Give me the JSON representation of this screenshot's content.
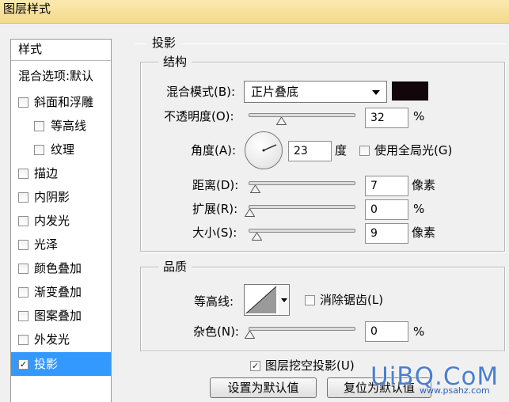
{
  "window": {
    "title": "图层样式"
  },
  "sidebar": {
    "header": "样式",
    "blend_options": "混合选项:默认",
    "items": [
      {
        "label": "斜面和浮雕",
        "checked": false,
        "selected": false
      },
      {
        "label": "等高线",
        "checked": false,
        "selected": false
      },
      {
        "label": "纹理",
        "checked": false,
        "selected": false
      },
      {
        "label": "描边",
        "checked": false,
        "selected": false
      },
      {
        "label": "内阴影",
        "checked": false,
        "selected": false
      },
      {
        "label": "内发光",
        "checked": false,
        "selected": false
      },
      {
        "label": "光泽",
        "checked": false,
        "selected": false
      },
      {
        "label": "颜色叠加",
        "checked": false,
        "selected": false
      },
      {
        "label": "渐变叠加",
        "checked": false,
        "selected": false
      },
      {
        "label": "图案叠加",
        "checked": false,
        "selected": false
      },
      {
        "label": "外发光",
        "checked": false,
        "selected": false
      },
      {
        "label": "投影",
        "checked": true,
        "selected": true
      }
    ]
  },
  "drop_shadow": {
    "section_title": "投影",
    "structure": {
      "title": "结构",
      "blend_mode_label": "混合模式(B):",
      "blend_mode_value": "正片叠底",
      "shadow_color": "#12060a",
      "opacity_label": "不透明度(O):",
      "opacity_value": "32",
      "opacity_unit": "%",
      "angle_label": "角度(A):",
      "angle_value": "23",
      "angle_unit": "度",
      "global_light_label": "使用全局光(G)",
      "global_light_checked": false,
      "distance_label": "距离(D):",
      "distance_value": "7",
      "distance_unit": "像素",
      "spread_label": "扩展(R):",
      "spread_value": "0",
      "spread_unit": "%",
      "size_label": "大小(S):",
      "size_value": "9",
      "size_unit": "像素"
    },
    "quality": {
      "title": "品质",
      "contour_label": "等高线:",
      "anti_alias_label": "消除锯齿(L)",
      "anti_alias_checked": false,
      "noise_label": "杂色(N):",
      "noise_value": "0",
      "noise_unit": "%"
    },
    "knockout_label": "图层挖空投影(U)",
    "knockout_checked": true,
    "make_default_button": "设置为默认值",
    "reset_default_button": "复位为默认值"
  },
  "watermark": {
    "main": "UiBQ.CoM",
    "sub": "www.psahz.com"
  },
  "colors": {
    "selection": "#3399ff",
    "titlebar": "#f3d98a"
  }
}
